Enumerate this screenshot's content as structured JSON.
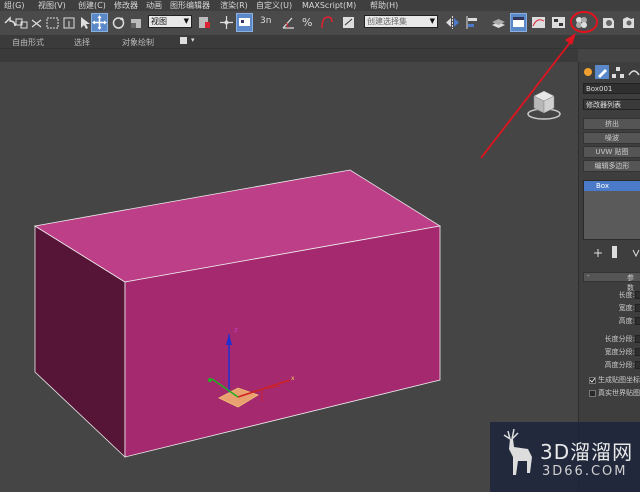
{
  "menu": {
    "items": [
      "组(G)",
      "视图(V)",
      "创建(C)",
      "修改器",
      "动画",
      "图形编辑器",
      "渲染(R)",
      "自定义(U)",
      "MAXScript(M)",
      "帮助(H)"
    ]
  },
  "toolbar": {
    "view_dropdown": "视图",
    "snap_label": "3n",
    "named_selection_placeholder": "创建选择集"
  },
  "ribbon": {
    "labels": [
      "自由形式",
      "选择",
      "对象绘制"
    ]
  },
  "command_panel": {
    "object_name": "Box001",
    "modifier_list": "修改器列表",
    "buttons": [
      "挤出",
      "噪波",
      "UVW 贴图",
      "编辑多边形"
    ],
    "stack_item": "Box",
    "rollout_title": "参数",
    "params": [
      "长度:",
      "宽度:",
      "高度:",
      "长度分段:",
      "宽度分段:",
      "高度分段:"
    ],
    "checkboxes": [
      "生成贴图坐标",
      "真实世界贴图大小"
    ]
  },
  "viewport": {
    "box_color": "#a3286e"
  },
  "watermark": {
    "brand": "3D溜溜网",
    "url": "3D66.COM"
  },
  "colors": {
    "accent": "#4a7ac8",
    "annotation": "#e0141e",
    "box_front": "#a5296f",
    "box_top": "#c0458a",
    "box_side": "#561536"
  }
}
